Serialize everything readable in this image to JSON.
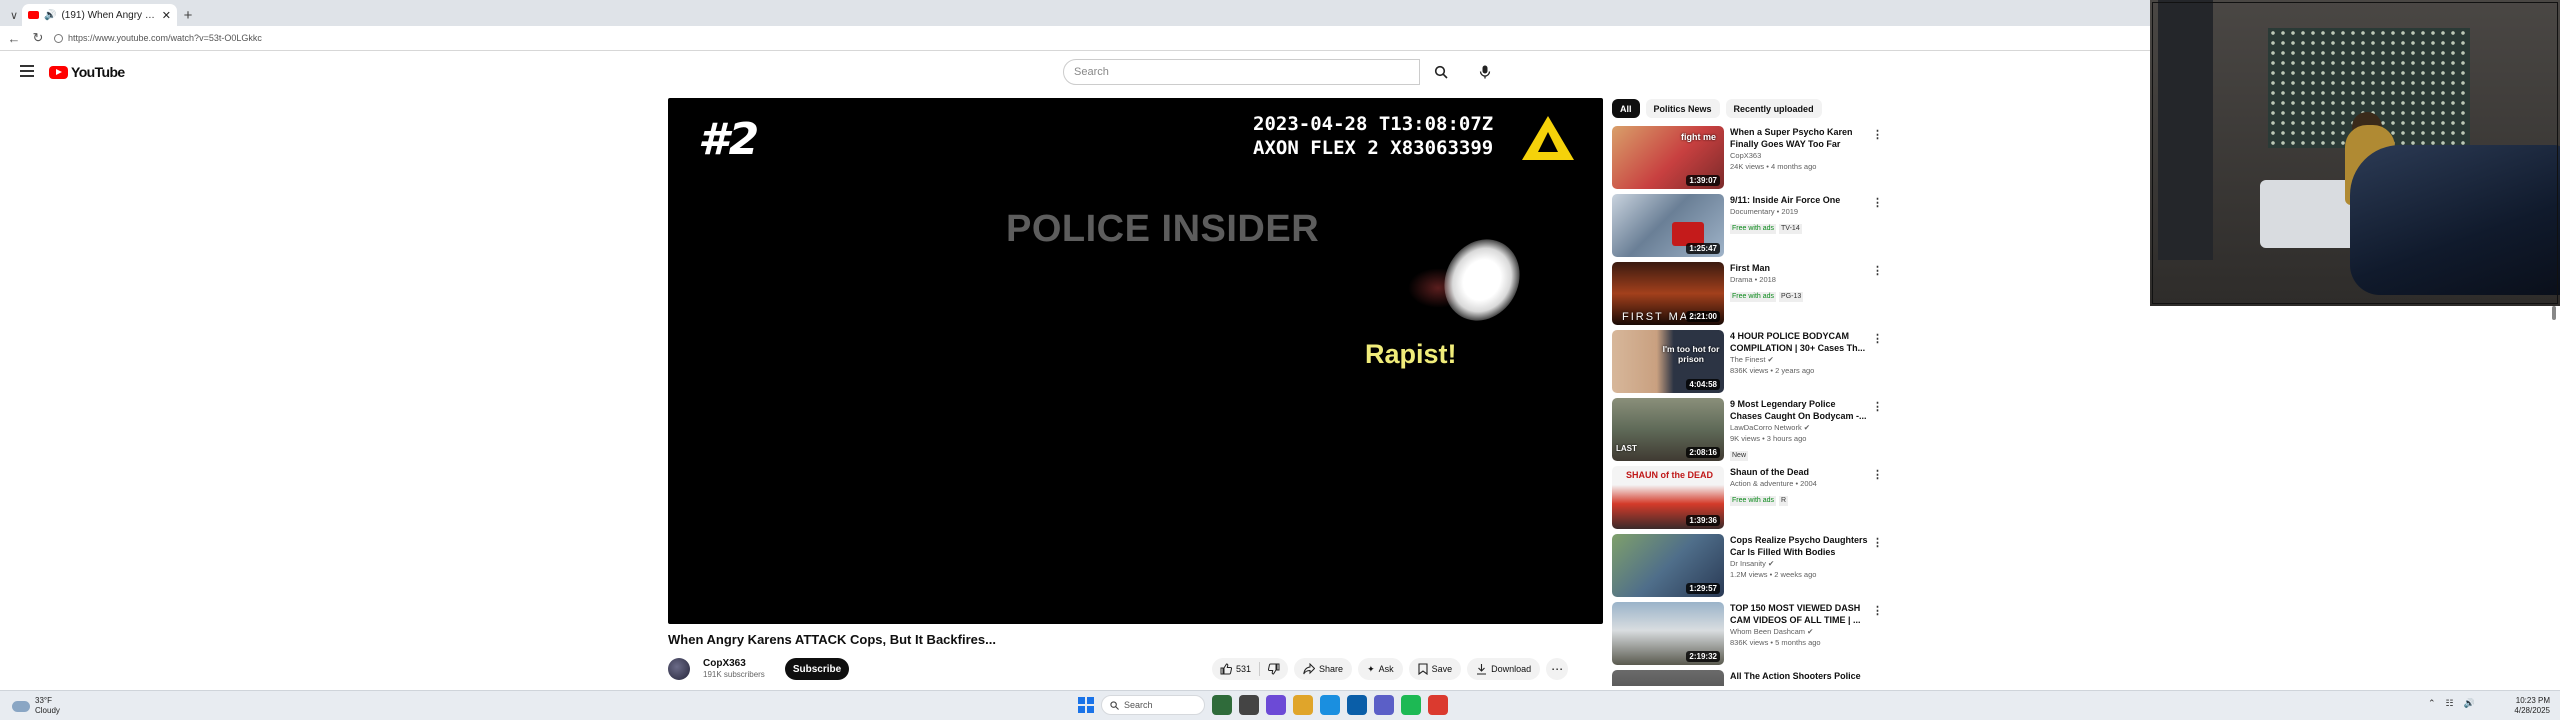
{
  "browser": {
    "tab_title": "(191) When Angry Karens A",
    "new_tab": "+",
    "url": "https://www.youtube.com/watch?v=53t-O0LGkkc"
  },
  "youtube": {
    "logo_text": "YouTube",
    "search_placeholder": "Search"
  },
  "player": {
    "overlay_number": "#2",
    "timestamp": "2023-04-28 T13:08:07Z",
    "device": "AXON FLEX 2 X83063399",
    "watermark": "POLICE INSIDER",
    "caption": "Rapist!"
  },
  "video": {
    "title": "When Angry Karens ATTACK Cops, But It Backfires...",
    "channel": "CopX363",
    "subscribers": "191K subscribers",
    "subscribe_label": "Subscribe",
    "likes": "531",
    "share_label": "Share",
    "ask_label": "Ask",
    "save_label": "Save",
    "download_label": "Download"
  },
  "sidebar": {
    "chips": [
      "All",
      "Politics News",
      "Recently uploaded"
    ],
    "recommendations": [
      {
        "title": "When a Super Psycho Karen Finally Goes WAY Too Far",
        "channel": "CopX363",
        "meta": "24K views • 4 months ago",
        "duration": "1:39:07",
        "thumb_text": "fight me",
        "badge": "",
        "rating": ""
      },
      {
        "title": "9/11: Inside Air Force One",
        "channel": "Documentary • 2019",
        "meta": "",
        "duration": "1:25:47",
        "thumb_text": "",
        "badge": "Free with ads",
        "rating": "TV-14"
      },
      {
        "title": "First Man",
        "channel": "Drama • 2018",
        "meta": "",
        "duration": "2:21:00",
        "thumb_text": "FIRST MAN",
        "badge": "Free with ads",
        "rating": "PG-13"
      },
      {
        "title": "4 HOUR POLICE BODYCAM COMPILATION | 30+ Cases Th...",
        "channel": "The Finest",
        "meta": "836K views • 2 years ago",
        "duration": "4:04:58",
        "thumb_text": "I'm too hot for prison",
        "badge": "",
        "rating": ""
      },
      {
        "title": "9 Most Legendary Police Chases Caught On Bodycam -...",
        "channel": "LawDaCorro Network",
        "meta": "9K views • 3 hours ago",
        "duration": "2:08:16",
        "thumb_text": "LAST",
        "badge": "New",
        "rating": ""
      },
      {
        "title": "Shaun of the Dead",
        "channel": "Action & adventure • 2004",
        "meta": "",
        "duration": "1:39:36",
        "thumb_text": "SHAUN of the DEAD",
        "badge": "Free with ads",
        "rating": "R"
      },
      {
        "title": "Cops Realize Psycho Daughters Car Is Filled With Bodies",
        "channel": "Dr Insanity",
        "meta": "1.2M views • 2 weeks ago",
        "duration": "1:29:57",
        "thumb_text": "",
        "badge": "",
        "rating": ""
      },
      {
        "title": "TOP 150 MOST VIEWED DASH CAM VIDEOS OF ALL TIME | ...",
        "channel": "Whom Been Dashcam",
        "meta": "836K views • 5 months ago",
        "duration": "2:19:32",
        "thumb_text": "",
        "badge": "",
        "rating": ""
      },
      {
        "title": "All The Action Shooters Police",
        "channel": "",
        "meta": "",
        "duration": "",
        "thumb_text": "",
        "badge": "",
        "rating": ""
      }
    ]
  },
  "taskbar": {
    "weather_temp": "33°F",
    "weather_desc": "Cloudy",
    "search_label": "Search",
    "time": "10:23 PM",
    "date": "4/28/2025"
  },
  "colors": {
    "accent": "#ff0000",
    "caption_yellow": "#f0ec7a",
    "free_with_ads": "#0a8a1a"
  }
}
